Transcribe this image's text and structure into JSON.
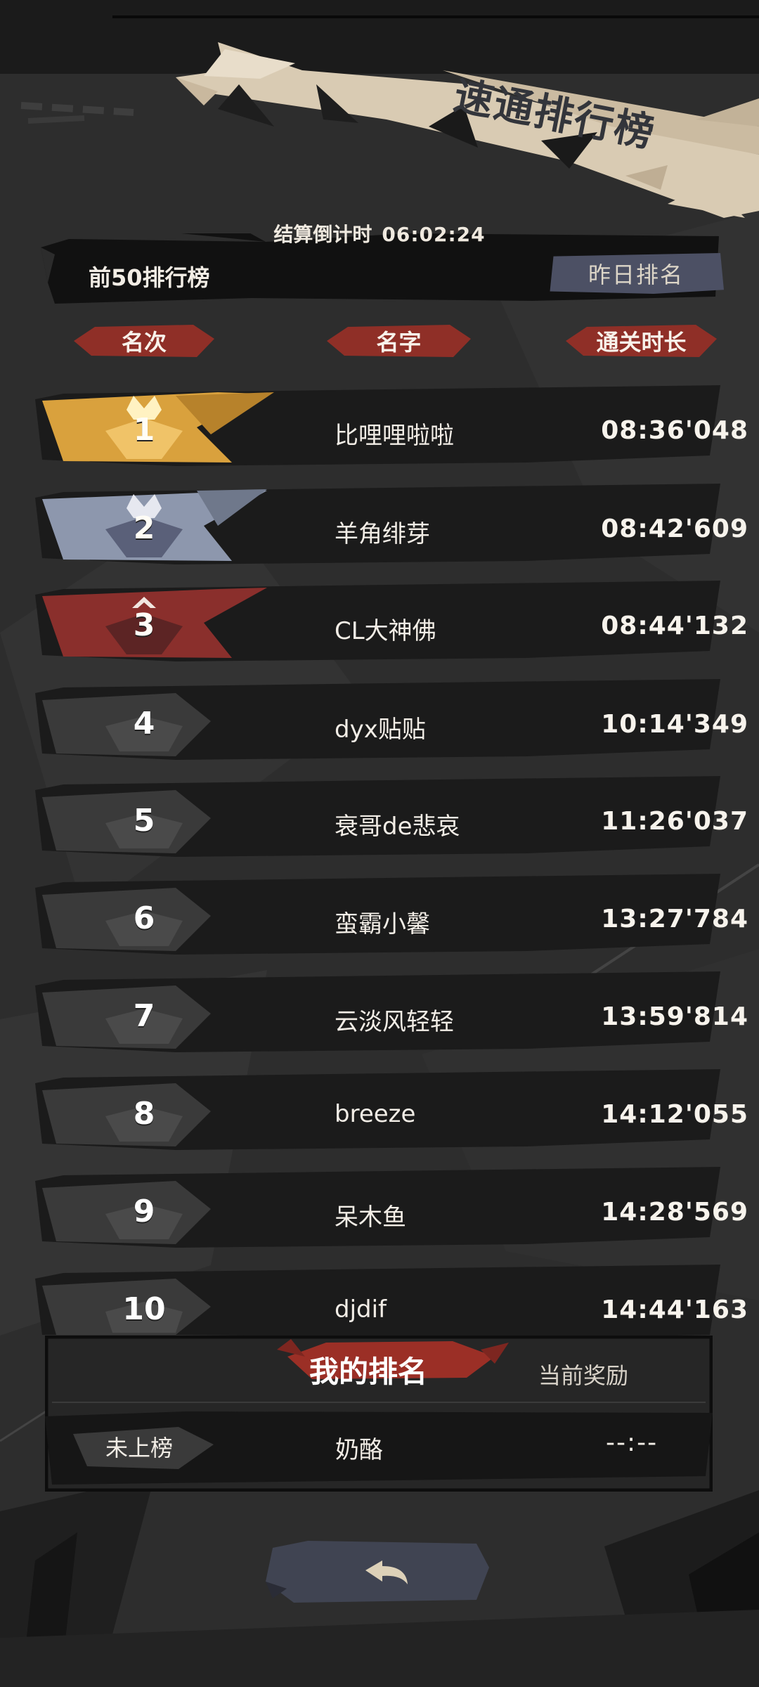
{
  "header": {
    "title": "速通排行榜",
    "countdown_label": "结算倒计时",
    "countdown_time": "06:02:24"
  },
  "board": {
    "label": "前50排行榜",
    "yesterday_button": "昨日排名"
  },
  "columns": {
    "rank": "名次",
    "name": "名字",
    "time": "通关时长"
  },
  "rows": [
    {
      "rank": "1",
      "name": "比哩哩啦啦",
      "time": "08:36'048",
      "badge": "gold-crown-badge"
    },
    {
      "rank": "2",
      "name": "羊角绯芽",
      "time": "08:42'609",
      "badge": "silver-crown-badge"
    },
    {
      "rank": "3",
      "name": "CL大神佛",
      "time": "08:44'132",
      "badge": "bronze-chevron-badge"
    },
    {
      "rank": "4",
      "name": "dyx贴贴",
      "time": "10:14'349",
      "badge": "plain-badge"
    },
    {
      "rank": "5",
      "name": "衰哥de悲哀",
      "time": "11:26'037",
      "badge": "plain-badge"
    },
    {
      "rank": "6",
      "name": "蛮霸小馨",
      "time": "13:27'784",
      "badge": "plain-badge"
    },
    {
      "rank": "7",
      "name": "云淡风轻轻",
      "time": "13:59'814",
      "badge": "plain-badge"
    },
    {
      "rank": "8",
      "name": "breeze",
      "time": "14:12'055",
      "badge": "plain-badge"
    },
    {
      "rank": "9",
      "name": "呆木鱼",
      "time": "14:28'569",
      "badge": "plain-badge"
    },
    {
      "rank": "10",
      "name": "djdif",
      "time": "14:44'163",
      "badge": "plain-badge"
    }
  ],
  "my_rank": {
    "title": "我的排名",
    "reward_label": "当前奖励",
    "rank": "未上榜",
    "name": "奶酪",
    "time": "--:--"
  },
  "icons": {
    "back": "back-arrow-icon"
  },
  "colors": {
    "gold": "#d9a13d",
    "silver": "#8d97ad",
    "bronze": "#8a2f2c",
    "accent_red": "#a8362b",
    "banner_paper": "#d9cbb3",
    "button_blue": "#4c5064"
  }
}
